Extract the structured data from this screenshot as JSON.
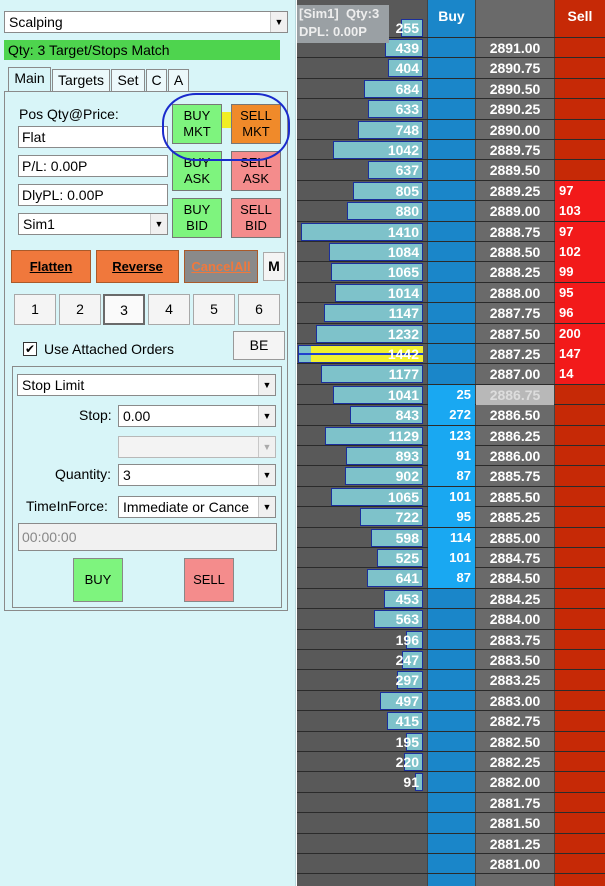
{
  "left": {
    "strategy": {
      "value": "Scalping"
    },
    "status": "Qty: 3 Target/Stops Match",
    "tabs": [
      "Main",
      "Targets",
      "Set",
      "C",
      "A"
    ],
    "position": {
      "label": "Pos Qty@Price:",
      "value": "Flat",
      "pl": "P/L: 0.00P",
      "dlypl": "DlyPL: 0.00P",
      "account": "Sim1"
    },
    "orders": {
      "buy_mkt": [
        "BUY",
        "MKT"
      ],
      "sell_mkt": [
        "SELL",
        "MKT"
      ],
      "buy_ask": [
        "BUY",
        "ASK"
      ],
      "sell_ask": [
        "SELL",
        "ASK"
      ],
      "buy_bid": [
        "BUY",
        "BID"
      ],
      "sell_bid": [
        "SELL",
        "BID"
      ]
    },
    "actions": {
      "flatten": "Flatten",
      "reverse": "Reverse",
      "cancel_all": "CancelAll",
      "m": "M"
    },
    "quick_qty": [
      "1",
      "2",
      "3",
      "4",
      "5",
      "6"
    ],
    "quick_qty_selected": "3",
    "use_attached_label": "Use Attached Orders",
    "use_attached_checked": true,
    "be_label": "BE",
    "entry": {
      "order_type": "Stop Limit",
      "stop_label": "Stop:",
      "stop_value": "0.00",
      "limit_value": "",
      "quantity_label": "Quantity:",
      "quantity_value": "3",
      "tif_label": "TimeInForce:",
      "tif_value": "Immediate or Cance",
      "time": "00:00:00",
      "buy": "BUY",
      "sell": "SELL"
    }
  },
  "ladder": {
    "header": {
      "account": "[Sim1]",
      "qty": "Qty:3",
      "dpl": "DPL: 0.00P",
      "buy": "Buy",
      "sell": "Sell"
    },
    "rows": [
      {
        "price": "2891.00",
        "vol": "439",
        "buy": "",
        "sell": ""
      },
      {
        "price": "2890.75",
        "vol": "404",
        "buy": "",
        "sell": ""
      },
      {
        "price": "2890.50",
        "vol": "684",
        "buy": "",
        "sell": ""
      },
      {
        "price": "2890.25",
        "vol": "633",
        "buy": "",
        "sell": ""
      },
      {
        "price": "2890.00",
        "vol": "748",
        "buy": "",
        "sell": ""
      },
      {
        "price": "2889.75",
        "vol": "1042",
        "buy": "",
        "sell": ""
      },
      {
        "price": "2889.50",
        "vol": "637",
        "buy": "",
        "sell": ""
      },
      {
        "price": "2889.25",
        "vol": "805",
        "buy": "",
        "sell": "97"
      },
      {
        "price": "2889.00",
        "vol": "880",
        "buy": "",
        "sell": "103"
      },
      {
        "price": "2888.75",
        "vol": "1410",
        "buy": "",
        "sell": "97"
      },
      {
        "price": "2888.50",
        "vol": "1084",
        "buy": "",
        "sell": "102"
      },
      {
        "price": "2888.25",
        "vol": "1065",
        "buy": "",
        "sell": "99"
      },
      {
        "price": "2888.00",
        "vol": "1014",
        "buy": "",
        "sell": "95"
      },
      {
        "price": "2887.75",
        "vol": "1147",
        "buy": "",
        "sell": "96"
      },
      {
        "price": "2887.50",
        "vol": "1232",
        "buy": "",
        "sell": "200"
      },
      {
        "price": "2887.25",
        "vol": "1442",
        "buy": "",
        "sell": "147"
      },
      {
        "price": "2887.00",
        "vol": "1177",
        "buy": "",
        "sell": "14"
      },
      {
        "price": "2886.75",
        "vol": "1041",
        "buy": "25",
        "sell": ""
      },
      {
        "price": "2886.50",
        "vol": "843",
        "buy": "272",
        "sell": ""
      },
      {
        "price": "2886.25",
        "vol": "1129",
        "buy": "123",
        "sell": ""
      },
      {
        "price": "2886.00",
        "vol": "893",
        "buy": "91",
        "sell": ""
      },
      {
        "price": "2885.75",
        "vol": "902",
        "buy": "87",
        "sell": ""
      },
      {
        "price": "2885.50",
        "vol": "1065",
        "buy": "101",
        "sell": ""
      },
      {
        "price": "2885.25",
        "vol": "722",
        "buy": "95",
        "sell": ""
      },
      {
        "price": "2885.00",
        "vol": "598",
        "buy": "114",
        "sell": ""
      },
      {
        "price": "2884.75",
        "vol": "525",
        "buy": "101",
        "sell": ""
      },
      {
        "price": "2884.50",
        "vol": "641",
        "buy": "87",
        "sell": ""
      },
      {
        "price": "2884.25",
        "vol": "453",
        "buy": "",
        "sell": ""
      },
      {
        "price": "2884.00",
        "vol": "563",
        "buy": "",
        "sell": ""
      },
      {
        "price": "2883.75",
        "vol": "196",
        "buy": "",
        "sell": ""
      },
      {
        "price": "2883.50",
        "vol": "247",
        "buy": "",
        "sell": ""
      },
      {
        "price": "2883.25",
        "vol": "297",
        "buy": "",
        "sell": ""
      },
      {
        "price": "2883.00",
        "vol": "497",
        "buy": "",
        "sell": ""
      },
      {
        "price": "2882.75",
        "vol": "415",
        "buy": "",
        "sell": ""
      },
      {
        "price": "2882.50",
        "vol": "195",
        "buy": "",
        "sell": ""
      },
      {
        "price": "2882.25",
        "vol": "220",
        "buy": "",
        "sell": ""
      },
      {
        "price": "2882.00",
        "vol": "91",
        "buy": "",
        "sell": ""
      },
      {
        "price": "2881.75",
        "vol": "",
        "buy": "",
        "sell": ""
      },
      {
        "price": "2881.50",
        "vol": "",
        "buy": "",
        "sell": ""
      },
      {
        "price": "2881.25",
        "vol": "",
        "buy": "",
        "sell": ""
      },
      {
        "price": "2881.00",
        "vol": "",
        "buy": "",
        "sell": ""
      }
    ],
    "top_partial_vol": "255",
    "last_price": "2886.75",
    "highlight_price": "2887.25",
    "vol_max": 1442,
    "colors": {
      "buy_col": "#1a86c9",
      "buy_cell": "#19a8f2",
      "sell_col": "#c62906",
      "sell_cell": "#f21a1a",
      "volume_bar": "#7ec2ca"
    }
  }
}
